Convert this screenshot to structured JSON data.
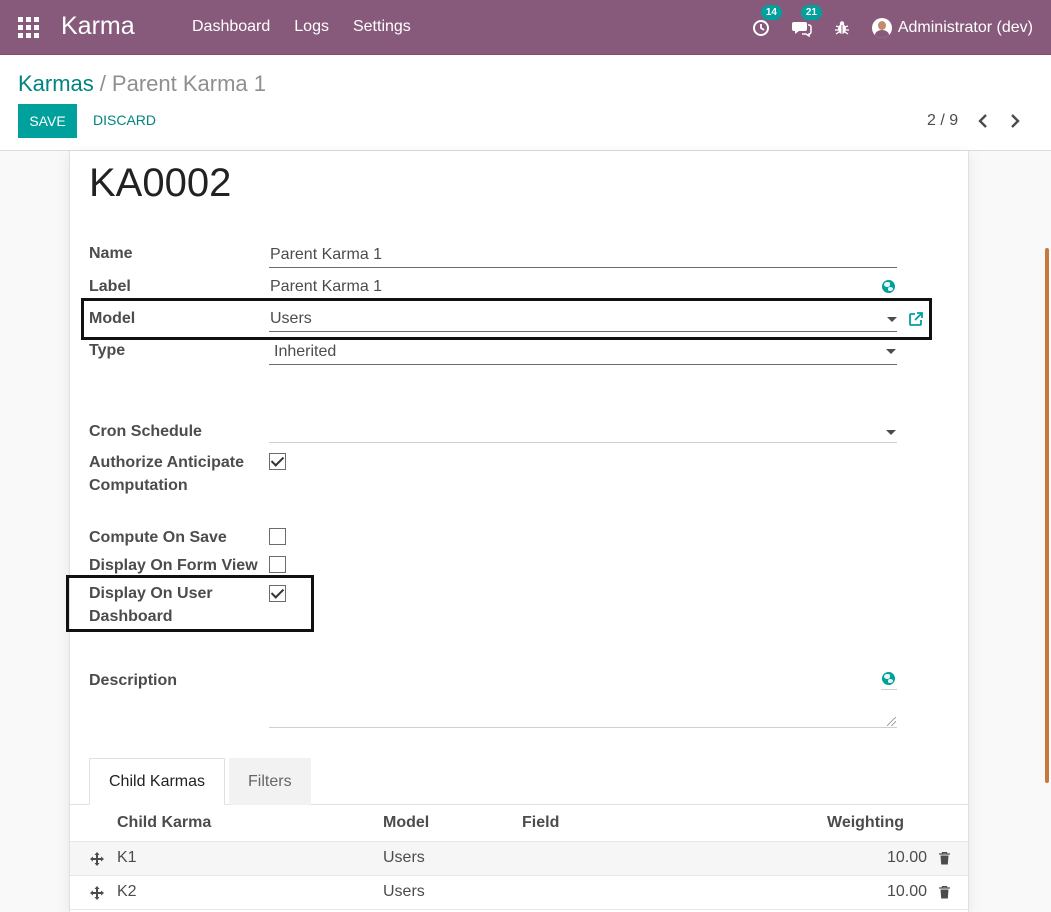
{
  "navbar": {
    "brand": "Karma",
    "menu": [
      "Dashboard",
      "Logs",
      "Settings"
    ],
    "activity_count": "14",
    "messages_count": "21",
    "user": "Administrator (dev)"
  },
  "control": {
    "breadcrumb_parent": "Karmas",
    "breadcrumb_sep": "/",
    "breadcrumb_current": "Parent Karma 1",
    "save_label": "SAVE",
    "discard_label": "DISCARD",
    "pager": "2 / 9"
  },
  "form": {
    "title": "KA0002",
    "name_label": "Name",
    "name_value": "Parent Karma 1",
    "label_label": "Label",
    "label_value": "Parent Karma 1",
    "model_label": "Model",
    "model_value": "Users",
    "type_label": "Type",
    "type_value": "Inherited",
    "cron_label": "Cron Schedule",
    "cron_value": "",
    "anticipate_label_1": "Authorize Anticipate",
    "anticipate_label_2": "Computation",
    "anticipate_checked": true,
    "compute_save_label": "Compute On Save",
    "compute_save_checked": false,
    "display_form_label": "Display On Form View",
    "display_form_checked": false,
    "display_dashboard_label_1": "Display On User",
    "display_dashboard_label_2": "Dashboard",
    "display_dashboard_checked": true,
    "description_label": "Description"
  },
  "tabs": [
    "Child Karmas",
    "Filters"
  ],
  "table": {
    "headers": [
      "Child Karma",
      "Model",
      "Field",
      "Weighting"
    ],
    "rows": [
      {
        "child": "K1",
        "model": "Users",
        "field": "",
        "weighting": "10.00"
      },
      {
        "child": "K2",
        "model": "Users",
        "field": "",
        "weighting": "10.00"
      }
    ]
  },
  "colors": {
    "navbar": "#875a7b",
    "accent": "#00a09d",
    "link": "#00847f"
  }
}
